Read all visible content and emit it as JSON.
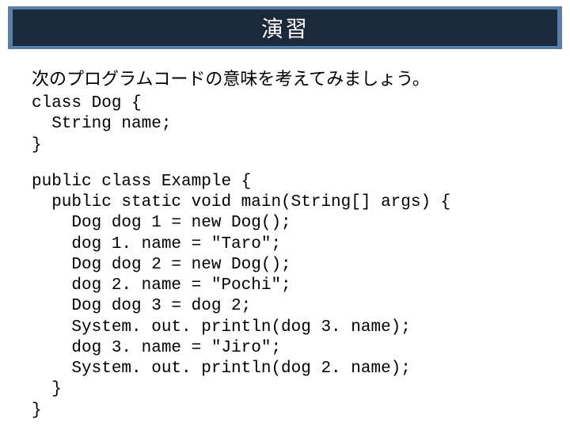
{
  "title": "演習",
  "subtitle": "次のプログラムコードの意味を考えてみましょう。",
  "code1": "class Dog {\n  String name;\n}",
  "code2": "public class Example {\n  public static void main(String[] args) {\n    Dog dog 1 = new Dog();\n    dog 1. name = \"Taro\";\n    Dog dog 2 = new Dog();\n    dog 2. name = \"Pochi\";\n    Dog dog 3 = dog 2;\n    System. out. println(dog 3. name);\n    dog 3. name = \"Jiro\";\n    System. out. println(dog 2. name);\n  }\n}"
}
